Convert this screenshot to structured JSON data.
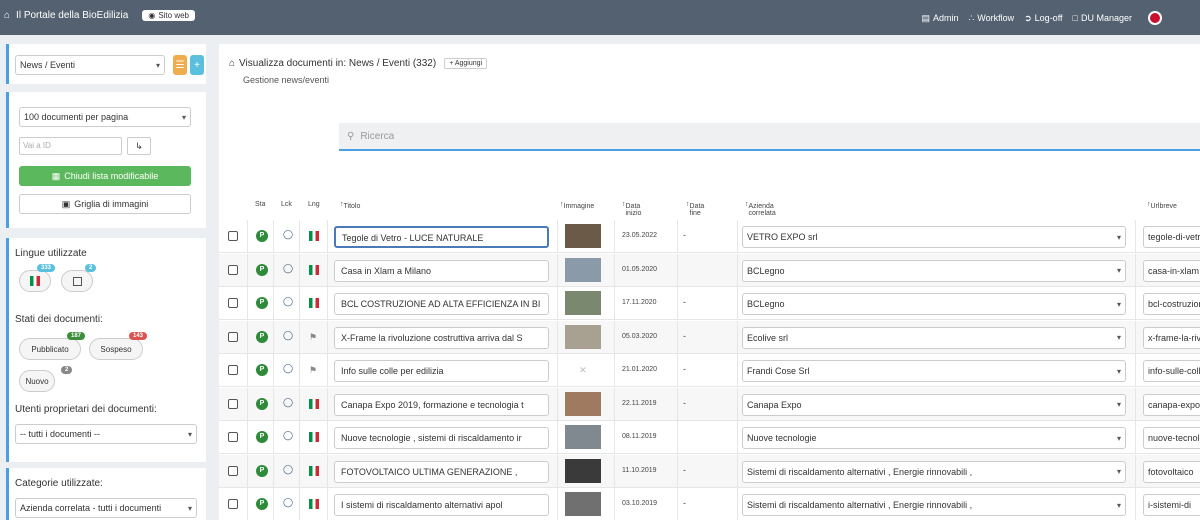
{
  "topbar": {
    "brand": "Il Portale della BioEdilizia",
    "site_badge": "Sito web",
    "nav": [
      "Admin",
      "Workflow",
      "Log-off",
      "DU Manager"
    ]
  },
  "sidebar": {
    "section_select": "News / Eventi",
    "per_page": "100 documenti per pagina",
    "id_placeholder": "Vai a ID",
    "close_list_btn": "Chiudi lista modificabile",
    "image_grid_btn": "Griglia di immagini",
    "languages_label": "Lingue utilizzate",
    "languages": [
      {
        "count": "333"
      },
      {
        "count": "2"
      }
    ],
    "states_label": "Stati dei documenti:",
    "states": [
      {
        "label": "Pubblicato",
        "count": "187"
      },
      {
        "label": "Sospeso",
        "count": "143"
      },
      {
        "label": "Nuovo",
        "count": "2"
      }
    ],
    "owners_label": "Utenti proprietari dei documenti:",
    "owners_value": "-- tutti i documenti --",
    "categories_label": "Categorie utilizzate:",
    "categories_value": "Azienda correlata - tutti i documenti"
  },
  "main": {
    "title": "Visualizza documenti in: News / Eventi (332)",
    "add_label": "Aggiungi",
    "subtitle": "Gestione news/eventi",
    "search_placeholder": "Ricerca",
    "columns": [
      "Sta",
      "Lck",
      "Lng",
      "Titolo",
      "Immagine",
      "Data inizio",
      "Data fine",
      "Azienda correlata",
      "Urlbreve"
    ],
    "rows": [
      {
        "title": "Tegole di Vetro - LUCE NATURALE",
        "date": "23.05.2022",
        "end": "-",
        "company": "VETRO EXPO srl",
        "slug": "tegole-di-vetro",
        "flag": "it",
        "focus": true,
        "thumb": "#6b5a48"
      },
      {
        "title": "Casa in Xlam a Milano",
        "date": "01.05.2020",
        "end": "",
        "company": "BCLegno",
        "slug": "casa-in-xlam",
        "flag": "it",
        "thumb": "#8a9aa8"
      },
      {
        "title": "BCL COSTRUZIONE AD ALTA EFFICIENZA IN BI",
        "date": "17.11.2020",
        "end": "-",
        "company": "BCLegno",
        "slug": "bcl-costruzione",
        "flag": "it",
        "thumb": "#7a8870"
      },
      {
        "title": "X-Frame la rivoluzione costruttiva arriva dal S",
        "date": "05.03.2020",
        "end": "-",
        "company": "Ecolive srl",
        "slug": "x-frame-la-riv",
        "flag": "empty",
        "thumb": "#a8a090"
      },
      {
        "title": "Info sulle colle per edilizia",
        "date": "21.01.2020",
        "end": "-",
        "company": "Frandi Cose Srl",
        "slug": "info-sulle-colle",
        "flag": "empty",
        "thumb": "none"
      },
      {
        "title": "Canapa Expo 2019, formazione e tecnologia t",
        "date": "22.11.2019",
        "end": "-",
        "company": "Canapa Expo",
        "slug": "canapa-expo",
        "flag": "it",
        "thumb": "#a07a60"
      },
      {
        "title": "Nuove tecnologie , sistemi di riscaldamento ir",
        "date": "08.11.2019",
        "end": "",
        "company": "Nuove tecnologie",
        "slug": "nuove-tecnologie",
        "flag": "it",
        "thumb": "#808890"
      },
      {
        "title": "FOTOVOLTAICO ULTIMA GENERAZIONE ,",
        "date": "11.10.2019",
        "end": "-",
        "company": "Sistemi di riscaldamento alternativi , Energie rinnovabili ,",
        "slug": "fotovoltaico",
        "flag": "it",
        "thumb": "#3a3a3a"
      },
      {
        "title": "I sistemi di riscaldamento alternativi apol",
        "date": "03.10.2019",
        "end": "-",
        "company": "Sistemi di riscaldamento alternativi , Energie rinnovabili ,",
        "slug": "i-sistemi-di",
        "flag": "it",
        "thumb": "#707070"
      }
    ]
  }
}
